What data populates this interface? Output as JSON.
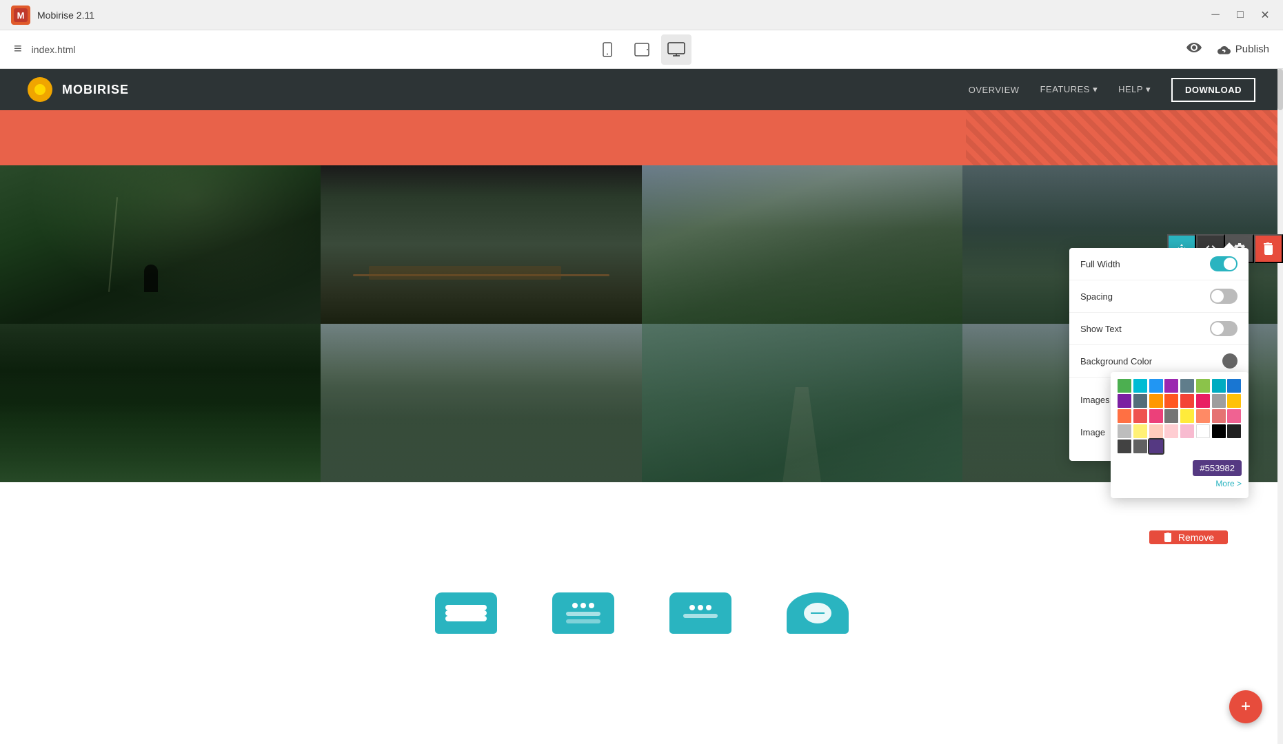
{
  "titleBar": {
    "appName": "Mobirise 2.11",
    "logoText": "M",
    "minimizeIcon": "─",
    "maximizeIcon": "□",
    "closeIcon": "✕"
  },
  "toolbar": {
    "hamburgerLabel": "≡",
    "fileName": "index.html",
    "deviceButtons": [
      {
        "id": "mobile",
        "icon": "📱",
        "label": "mobile-view"
      },
      {
        "id": "tablet",
        "icon": "⬜",
        "label": "tablet-view"
      },
      {
        "id": "desktop",
        "icon": "🖥",
        "label": "desktop-view",
        "active": true
      }
    ],
    "previewIcon": "👁",
    "publishIcon": "☁",
    "publishLabel": "Publish"
  },
  "siteNav": {
    "brand": "MOBIRISE",
    "links": [
      {
        "label": "OVERVIEW",
        "dropdown": false
      },
      {
        "label": "FEATURES",
        "dropdown": true
      },
      {
        "label": "HELP",
        "dropdown": true
      }
    ],
    "downloadBtn": "DOWNLOAD"
  },
  "blockControls": {
    "buttons": [
      {
        "id": "move",
        "icon": "⇅",
        "type": "teal"
      },
      {
        "id": "code",
        "icon": "</>",
        "type": "code"
      },
      {
        "id": "settings",
        "icon": "⚙",
        "type": "gear"
      },
      {
        "id": "delete",
        "icon": "🗑",
        "type": "red"
      }
    ]
  },
  "settingsPanel": {
    "rows": [
      {
        "label": "Full Width",
        "control": "toggle",
        "value": "on"
      },
      {
        "label": "Spacing",
        "control": "toggle",
        "value": "off"
      },
      {
        "label": "Show Text",
        "control": "toggle",
        "value": "off"
      },
      {
        "label": "Background Color",
        "control": "color",
        "value": "#666666"
      }
    ],
    "imagesLabel": "Images",
    "imageLabel": "Image",
    "navPrev": "‹",
    "navNext": "›",
    "moreLabel": "More >"
  },
  "colorPicker": {
    "swatches": [
      "#4caf50",
      "#00bcd4",
      "#2196f3",
      "#9c27b0",
      "#607d8b",
      "#8bc34a",
      "#00acc1",
      "#1976d2",
      "#7b1fa2",
      "#546e7a",
      "#ff9800",
      "#ff5722",
      "#f44336",
      "#e91e63",
      "#9e9e9e",
      "#ffc107",
      "#ff7043",
      "#ef5350",
      "#ec407a",
      "#757575",
      "#ffeb3b",
      "#ff8a65",
      "#e57373",
      "#f06292",
      "#bdbdbd",
      "#fff176",
      "#ffccbc",
      "#ffcdd2",
      "#f8bbd0",
      "#ffffff",
      "#000000",
      "#212121"
    ],
    "hexValue": "#553982",
    "moreLabel": "More >"
  },
  "removeBtn": {
    "icon": "🗑",
    "label": "Remove"
  },
  "addFab": {
    "icon": "+"
  }
}
